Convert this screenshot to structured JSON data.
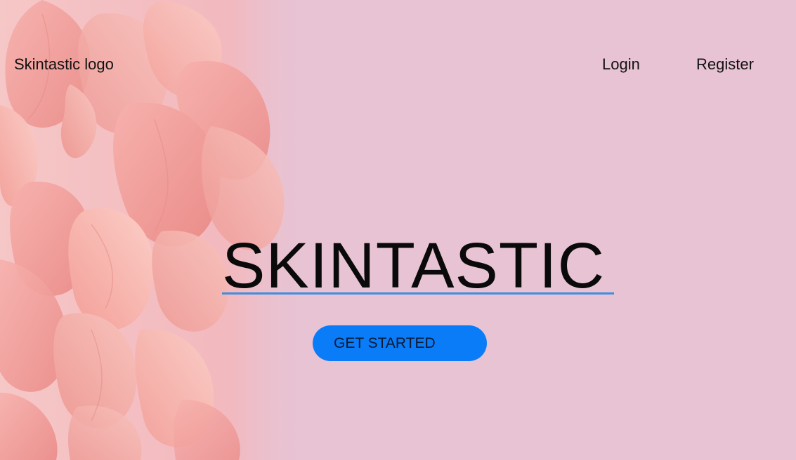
{
  "header": {
    "logo_text": "Skintastic logo",
    "nav": {
      "login": "Login",
      "register": "Register"
    }
  },
  "hero": {
    "title": "SKINTASTIC",
    "cta_label": "GET STARTED"
  },
  "colors": {
    "background": "#e8c3d3",
    "accent": "#0a7cf8",
    "underline": "#3d8ee0",
    "petal": "#f0a0a0"
  },
  "decor": {
    "image": "rose-petals-image"
  }
}
